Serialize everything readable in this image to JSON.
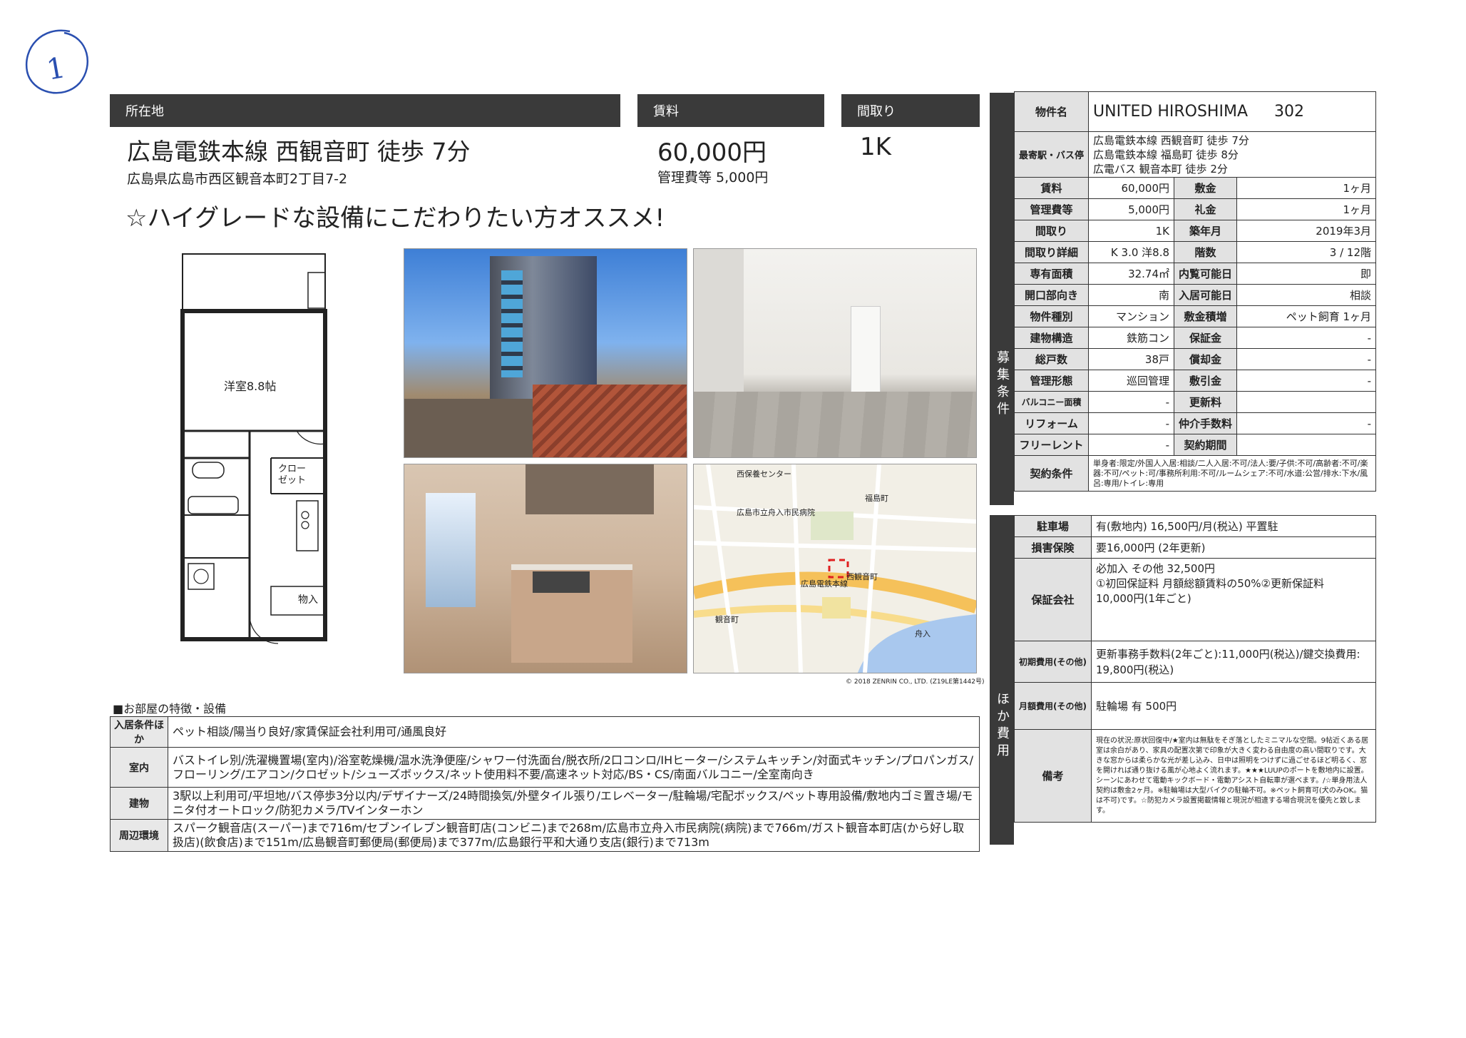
{
  "annotation": {
    "circle_text": "1"
  },
  "headers": {
    "location": "所在地",
    "rent": "賃料",
    "layout": "間取り"
  },
  "access": "広島電鉄本線 西観音町 徒歩 7分",
  "address": "広島県広島市西区観音本町2丁目7-2",
  "rent": "60,000円",
  "mgmt_fee": "管理費等 5,000円",
  "layout": "1K",
  "catch": "☆ハイグレードな設備にこだわりたい方オススメ!",
  "floor_plan": {
    "room": "洋室8.8帖",
    "closet": "クロー\nゼット",
    "storage": "物入"
  },
  "map": {
    "labels": [
      "西保養センター",
      "広島電鉄本線",
      "福島町",
      "西観音町",
      "観音町",
      "舟入",
      "広島市立舟入市民病院"
    ],
    "credit": "© 2018 ZENRIN CO., LTD. (Z19LE第1442号)"
  },
  "features": {
    "heading": "■お部屋の特徴・設備",
    "rows": [
      {
        "label": "入居条件ほか",
        "value": "ペット相談/陽当り良好/家賃保証会社利用可/通風良好"
      },
      {
        "label": "室内",
        "value": "バストイレ別/洗濯機置場(室内)/浴室乾燥機/温水洗浄便座/シャワー付洗面台/脱衣所/2口コンロ/IHヒーター/システムキッチン/対面式キッチン/プロパンガス/フローリング/エアコン/クロゼット/シューズボックス/ネット使用料不要/高速ネット対応/BS・CS/南面バルコニー/全室南向き"
      },
      {
        "label": "建物",
        "value": "3駅以上利用可/平坦地/バス停歩3分以内/デザイナーズ/24時間換気/外壁タイル張り/エレベーター/駐輪場/宅配ボックス/ペット専用設備/敷地内ゴミ置き場/モニタ付オートロック/防犯カメラ/TVインターホン"
      },
      {
        "label": "周辺環境",
        "value": "スパーク観音店(スーパー)まで716m/セブンイレブン観音町店(コンビニ)まで268m/広島市立舟入市民病院(病院)まで766m/ガスト観音本町店(から好し取扱店)(飲食店)まで151m/広島観音町郵便局(郵便局)まで377m/広島銀行平和大通り支店(銀行)まで713m"
      }
    ]
  },
  "panel": {
    "name_label": "物件名",
    "name": "UNITED HIROSHIMA",
    "room_no": "302",
    "station_label": "最寄駅・バス停",
    "stations": [
      "広島電鉄本線 西観音町 徒歩 7分",
      "広島電鉄本線 福島町 徒歩 8分",
      "広電バス 観音本町 徒歩 2分"
    ],
    "side1": "募集条件",
    "side2": "ほか費用",
    "pairs": [
      [
        "賃料",
        "60,000円",
        "敷金",
        "1ヶ月"
      ],
      [
        "管理費等",
        "5,000円",
        "礼金",
        "1ヶ月"
      ],
      [
        "間取り",
        "1K",
        "築年月",
        "2019年3月"
      ],
      [
        "間取り詳細",
        "K 3.0 洋8.8",
        "階数",
        "3 / 12階"
      ],
      [
        "専有面積",
        "32.74㎡",
        "内覧可能日",
        "即"
      ],
      [
        "開口部向き",
        "南",
        "入居可能日",
        "相談"
      ],
      [
        "物件種別",
        "マンション",
        "敷金積増",
        "ペット飼育 1ヶ月"
      ],
      [
        "建物構造",
        "鉄筋コン",
        "保証金",
        "-"
      ],
      [
        "総戸数",
        "38戸",
        "償却金",
        "-"
      ],
      [
        "管理形態",
        "巡回管理",
        "敷引金",
        "-"
      ],
      [
        "バルコニー面積",
        "-",
        "更新料",
        ""
      ],
      [
        "リフォーム",
        "-",
        "仲介手数料",
        "-"
      ],
      [
        "フリーレント",
        "-",
        "契約期間",
        ""
      ]
    ],
    "contract_label": "契約条件",
    "contract": "単身者:限定/外国人入居:相談/二人入居:不可/法人:要/子供:不可/高齢者:不可/楽器:不可/ペット:可/事務所利用:不可/ルームシェア:不可/水道:公営/排水:下水/風呂:専用/トイレ:専用",
    "costs": [
      {
        "label": "駐車場",
        "value": "有(敷地内) 16,500円/月(税込) 平置駐"
      },
      {
        "label": "損害保険",
        "value": "要16,000円 (2年更新)"
      },
      {
        "label": "保証会社",
        "value": "必加入 その他 32,500円\n①初回保証料 月額総額賃料の50%②更新保証料\n10,000円(1年ごと)"
      },
      {
        "label": "初期費用(その他)",
        "value": "更新事務手数料(2年ごと):11,000円(税込)/鍵交換費用:\n19,800円(税込)"
      },
      {
        "label": "月額費用(その他)",
        "value": "駐輪場 有 500円"
      },
      {
        "label": "備考",
        "value": "現在の状況:原状回復中/★室内は無駄をそぎ落としたミニマルな空間。9帖近くある居室は余白があり、家具の配置次第で印象が大きく変わる自由度の高い間取りです。大きな窓からは柔らかな光が差し込み、日中は照明をつけずに過ごせるほど明るく、窓を開ければ通り抜ける風が心地よく流れます。★★★LUUPのポートを敷地内に設置。シーンにあわせて電動キックボード・電動アシスト自転車が選べます。/☆単身用法人契約は敷金2ヶ月。※駐輪場は大型バイクの駐輪不可。※ペット飼育可(犬のみOK。猫は不可)です。☆防犯カメラ設置掲載情報と現況が相違する場合現況を優先と致します。"
      }
    ]
  }
}
